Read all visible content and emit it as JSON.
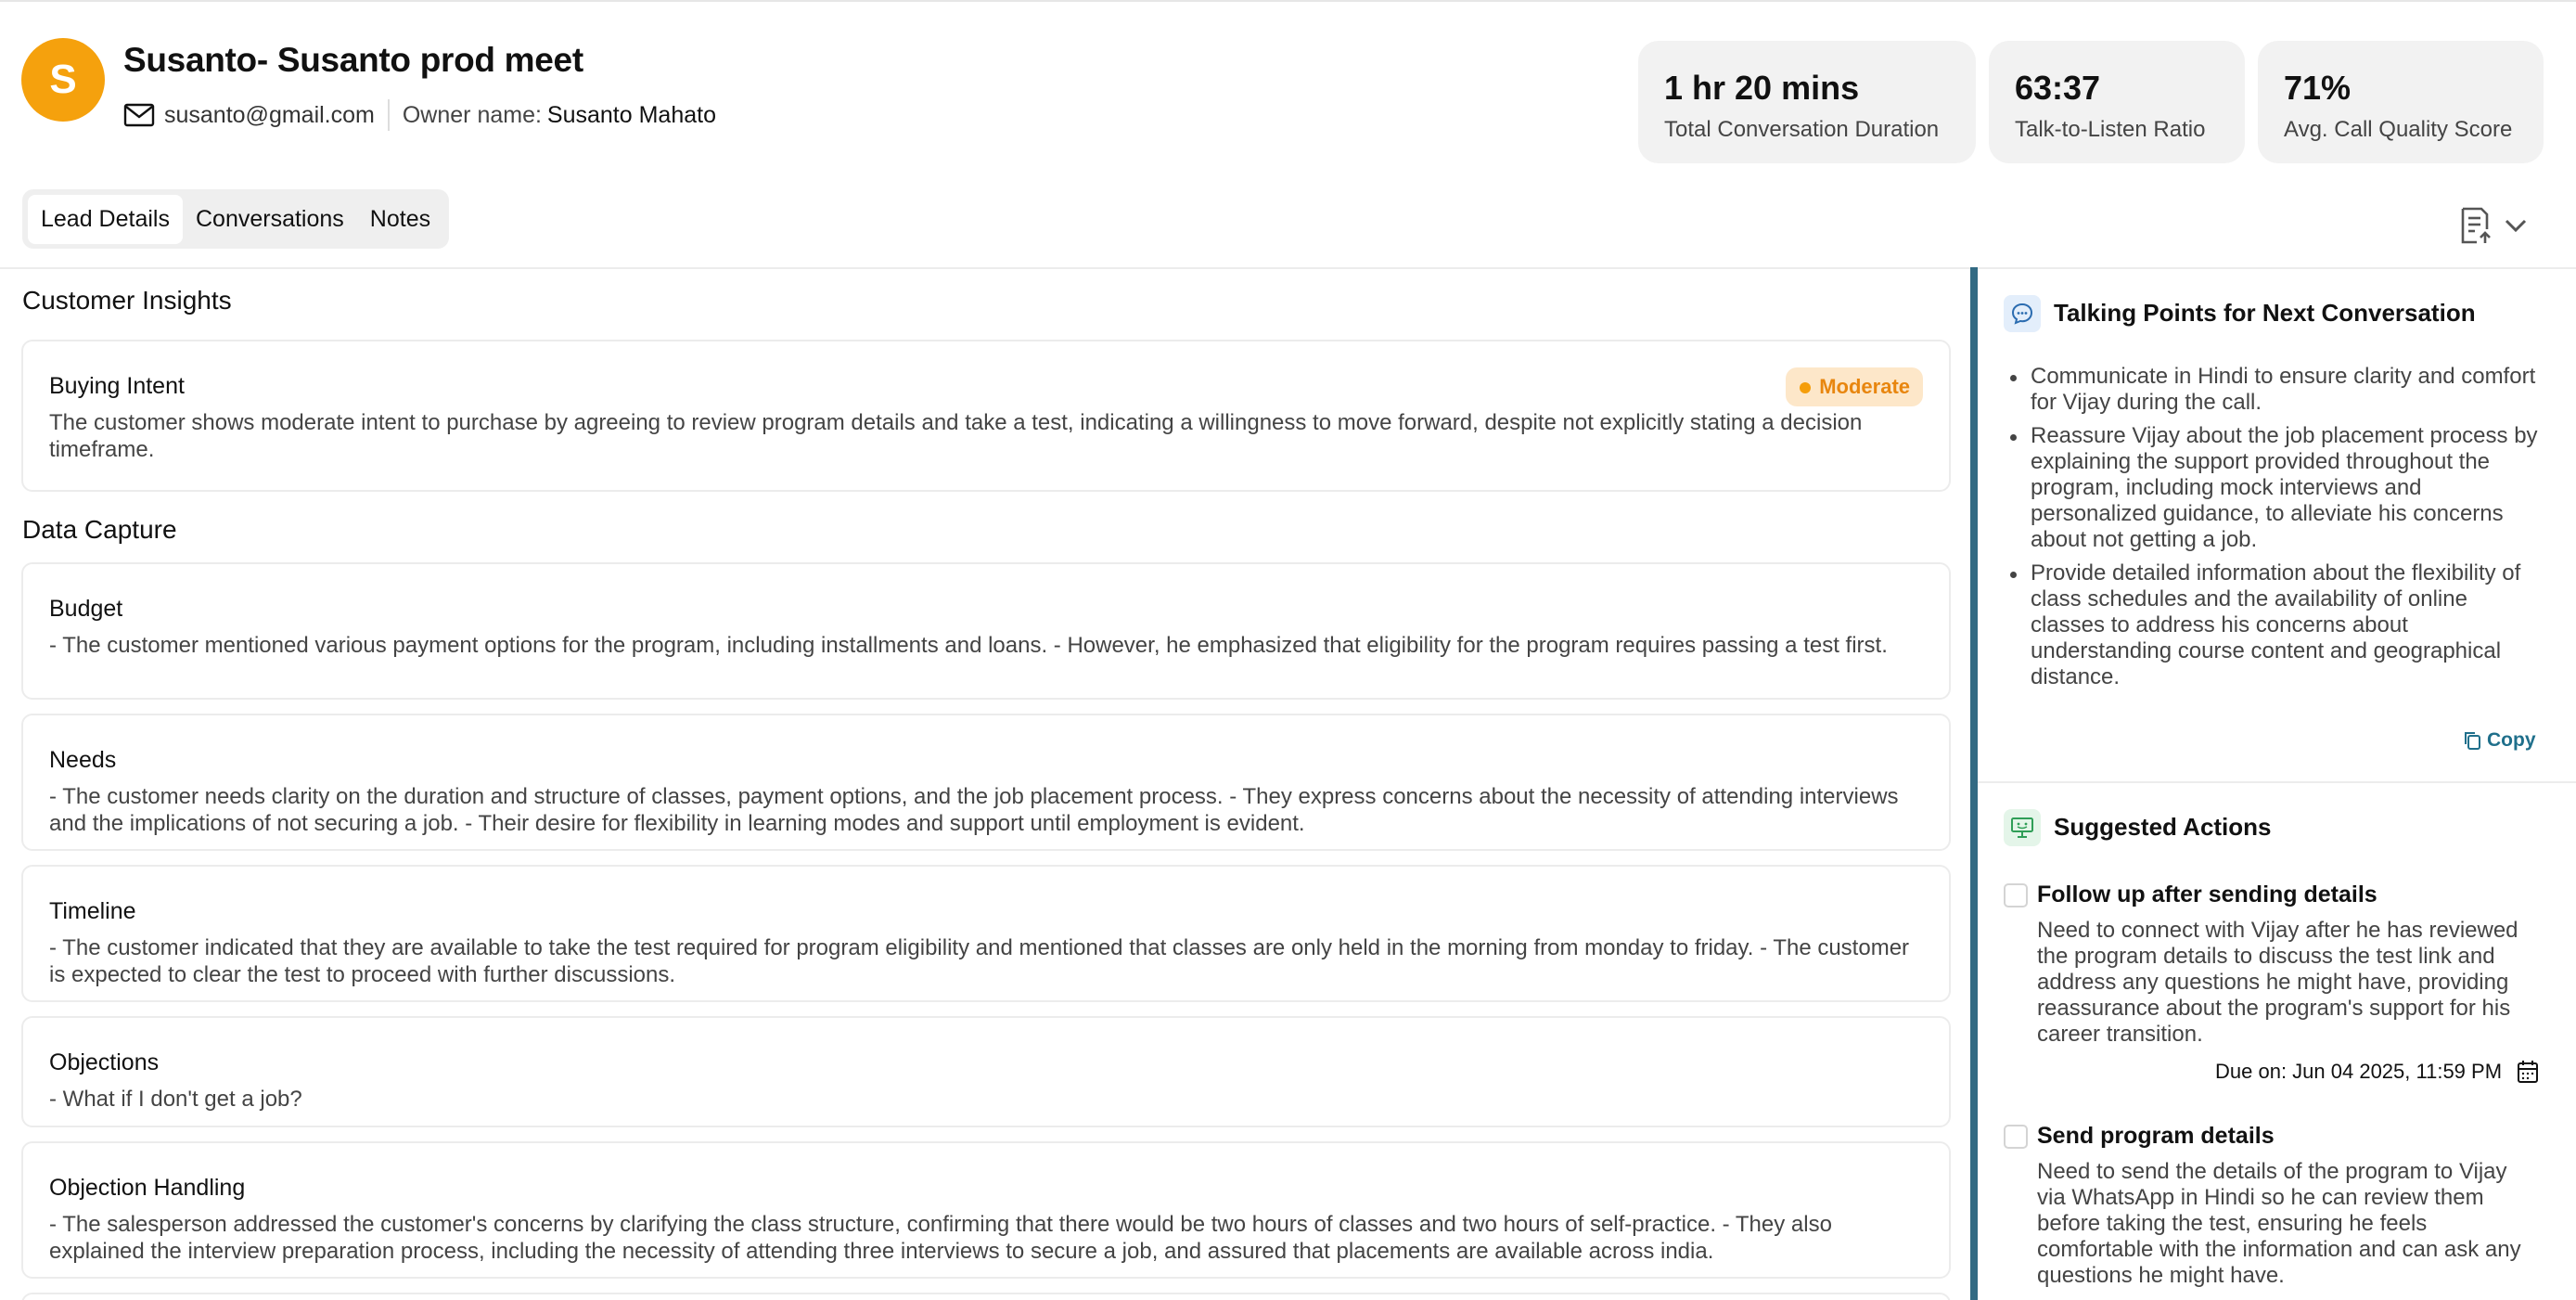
{
  "header": {
    "avatar_initial": "S",
    "title": "Susanto- Susanto prod meet",
    "email": "susanto@gmail.com",
    "owner_label": "Owner name:",
    "owner_name": "Susanto Mahato"
  },
  "stats": [
    {
      "value": "1 hr 20 mins",
      "label": "Total Conversation Duration"
    },
    {
      "value": "63:37",
      "label": "Talk-to-Listen Ratio"
    },
    {
      "value": "71%",
      "label": "Avg. Call Quality Score"
    }
  ],
  "tabs": [
    {
      "label": "Lead Details",
      "active": true
    },
    {
      "label": "Conversations",
      "active": false
    },
    {
      "label": "Notes",
      "active": false
    }
  ],
  "toolbar": {
    "export_icon": "document-upload-icon",
    "dropdown_icon": "chevron-down-icon"
  },
  "insights": {
    "section_title": "Customer Insights",
    "buying_intent": {
      "title": "Buying Intent",
      "badge": "Moderate",
      "body": "The customer shows moderate intent to purchase by agreeing to review program details and take a test, indicating a willingness to move forward, despite not explicitly stating a decision timeframe."
    }
  },
  "data_capture": {
    "section_title": "Data Capture",
    "items": [
      {
        "title": "Budget",
        "body": "- The customer mentioned various payment options for the program, including installments and loans. - However, he emphasized that eligibility for the program requires passing a test first."
      },
      {
        "title": "Needs",
        "body": "- The customer needs clarity on the duration and structure of classes, payment options, and the job placement process. - They express concerns about the necessity of attending interviews and the implications of not securing a job. - Their desire for flexibility in learning modes and support until employment is evident."
      },
      {
        "title": "Timeline",
        "body": "- The customer indicated that they are available to take the test required for program eligibility and mentioned that classes are only held in the morning from monday to friday. - The customer is expected to clear the test to proceed with further discussions."
      },
      {
        "title": "Objections",
        "body": "- What if I don't get a job?"
      },
      {
        "title": "Objection Handling",
        "body": "- The salesperson addressed the customer's concerns by clarifying the class structure, confirming that there would be two hours of classes and two hours of self-practice. - They also explained the interview preparation process, including the necessity of attending three interviews to secure a job, and assured that placements are available across india."
      }
    ]
  },
  "talking_points": {
    "title": "Talking Points for Next Conversation",
    "items": [
      "Communicate in Hindi to ensure clarity and comfort for Vijay during the call.",
      "Reassure Vijay about the job placement process by explaining the support provided throughout the program, including mock interviews and personalized guidance, to alleviate his concerns about not getting a job.",
      "Provide detailed information about the flexibility of class schedules and the availability of online classes to address his concerns about understanding course content and geographical distance."
    ],
    "copy_label": "Copy"
  },
  "suggested_actions": {
    "title": "Suggested Actions",
    "items": [
      {
        "title": "Follow up after sending details",
        "body": "Need to connect with Vijay after he has reviewed the program details to discuss the test link and address any questions he might have, providing reassurance about the program's support for his career transition.",
        "due": "Due on: Jun 04 2025, 11:59 PM"
      },
      {
        "title": "Send program details",
        "body": "Need to send the details of the program to Vijay via WhatsApp in Hindi so he can review them before taking the test, ensuring he feels comfortable with the information and can ask any questions he might have."
      }
    ]
  },
  "colors": {
    "avatar": "#f5a10d",
    "accent": "#326a83",
    "badge_bg": "#fde7c9",
    "badge_text": "#e8860f",
    "copy": "#1f6f8b"
  }
}
